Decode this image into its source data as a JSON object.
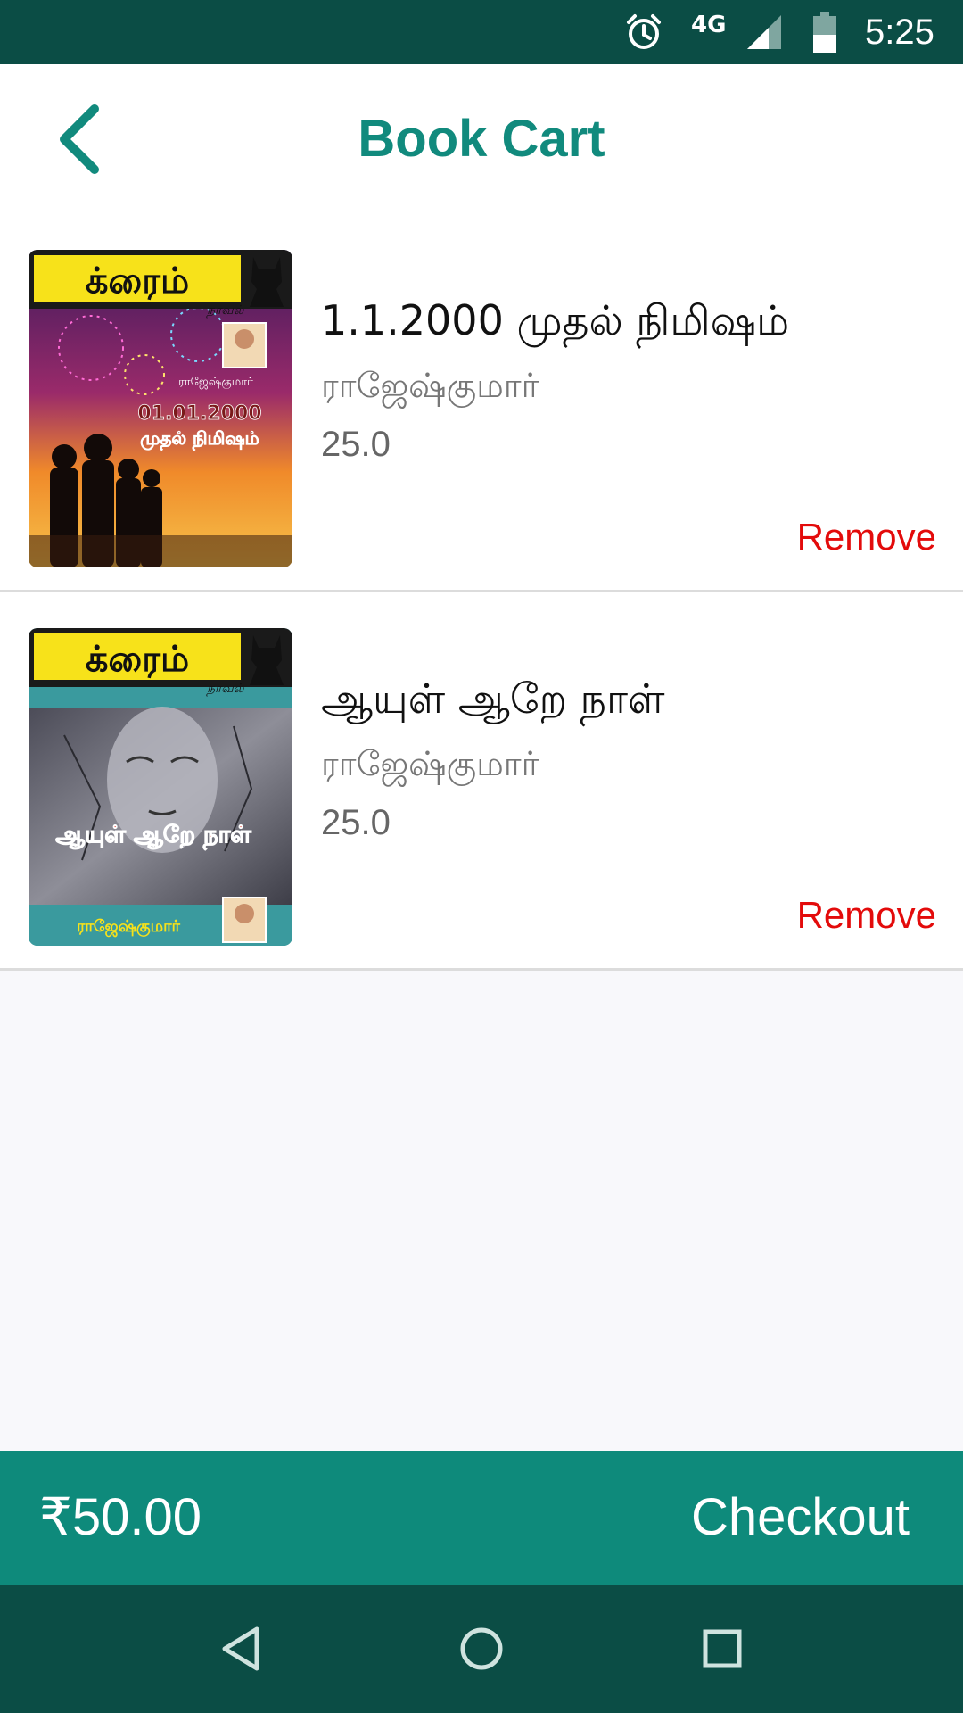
{
  "status_bar": {
    "network": "4G",
    "time": "5:25",
    "icons": [
      "alarm-icon",
      "signal-icon",
      "battery-icon"
    ]
  },
  "header": {
    "title": "Book Cart",
    "back_icon": "chevron-left-icon"
  },
  "cart": {
    "items": [
      {
        "title": "1.1.2000 முதல் நிமிஷம்",
        "author": "ராஜேஷ்குமார்",
        "price": "25.0",
        "remove_label": "Remove",
        "cover": {
          "brand": "க்ரைம்",
          "sub": "நாவல்",
          "author": "ராஜேஷ்குமார்",
          "date": "01.01.2000",
          "title": "முதல் நிமிஷம்"
        }
      },
      {
        "title": "ஆயுள் ஆறே நாள்",
        "author": "ராஜேஷ்குமார்",
        "price": "25.0",
        "remove_label": "Remove",
        "cover": {
          "brand": "க்ரைம்",
          "sub": "நாவல்",
          "title": "ஆயுள் ஆறே நாள்",
          "author": "ராஜேஷ்குமார்"
        }
      }
    ]
  },
  "footer": {
    "total": "₹50.00",
    "checkout_label": "Checkout"
  },
  "colors": {
    "primary": "#0e8a7b",
    "primary_dark": "#0b4d45",
    "title_teal": "#118a7d",
    "remove_red": "#e30b0b"
  }
}
